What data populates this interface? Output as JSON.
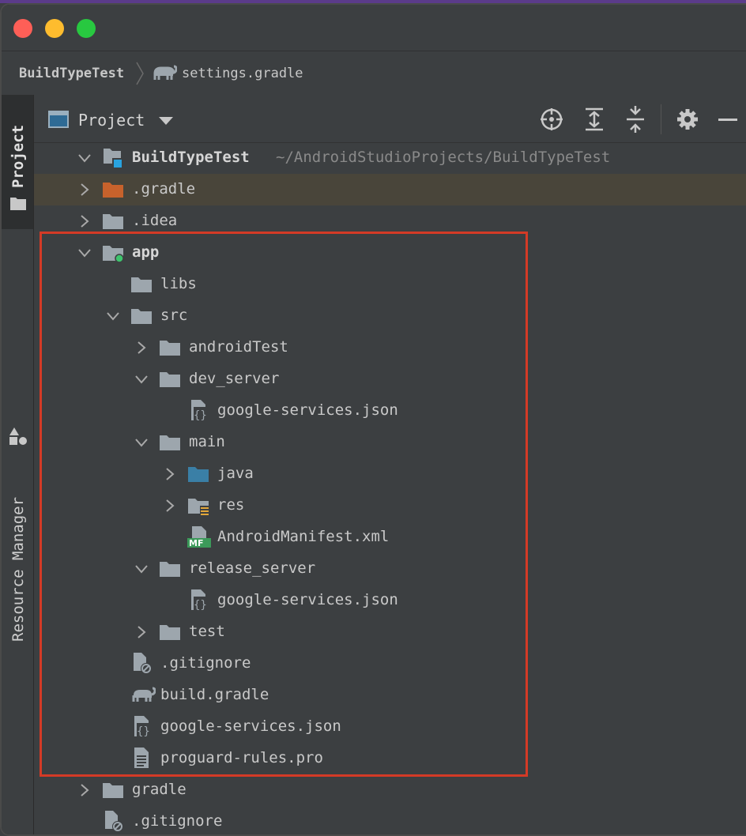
{
  "window": {
    "breadcrumb": {
      "project": "BuildTypeTest",
      "file": "settings.gradle"
    }
  },
  "sidebar": {
    "project_tab": "Project",
    "resource_tab": "Resource Manager"
  },
  "toolbar": {
    "view_label": "Project"
  },
  "tree": {
    "root": {
      "label": "BuildTypeTest",
      "path": "~/AndroidStudioProjects/BuildTypeTest"
    },
    "items": [
      {
        "label": ".gradle"
      },
      {
        "label": ".idea"
      },
      {
        "label": "app"
      },
      {
        "label": "libs"
      },
      {
        "label": "src"
      },
      {
        "label": "androidTest"
      },
      {
        "label": "dev_server"
      },
      {
        "label": "google-services.json"
      },
      {
        "label": "main"
      },
      {
        "label": "java"
      },
      {
        "label": "res"
      },
      {
        "label": "AndroidManifest.xml"
      },
      {
        "label": "release_server"
      },
      {
        "label": "google-services.json"
      },
      {
        "label": "test"
      },
      {
        "label": ".gitignore"
      },
      {
        "label": "build.gradle"
      },
      {
        "label": "google-services.json"
      },
      {
        "label": "proguard-rules.pro"
      },
      {
        "label": "gradle"
      },
      {
        "label": ".gitignore"
      }
    ]
  },
  "colors": {
    "highlight_box": "#d43a26",
    "folder": "#9da6ad",
    "orange_folder": "#c7622c",
    "blue_folder": "#3a7fa6"
  }
}
